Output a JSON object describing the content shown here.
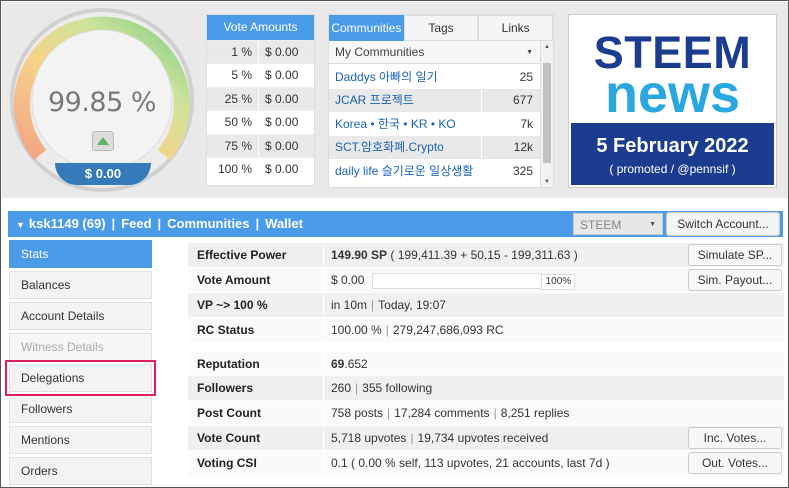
{
  "gauge": {
    "percent": "99.85 %",
    "usd": "$ 0.00",
    "value": 99.85
  },
  "vote_amounts": {
    "title": "Vote Amounts",
    "rows": [
      {
        "pct": "1 %",
        "usd": "$ 0.00"
      },
      {
        "pct": "5 %",
        "usd": "$ 0.00"
      },
      {
        "pct": "25 %",
        "usd": "$ 0.00"
      },
      {
        "pct": "50 %",
        "usd": "$ 0.00"
      },
      {
        "pct": "75 %",
        "usd": "$ 0.00"
      },
      {
        "pct": "100 %",
        "usd": "$ 0.00"
      }
    ]
  },
  "communities": {
    "tabs": [
      "Communities",
      "Tags",
      "Links"
    ],
    "selected": "My Communities",
    "rows": [
      {
        "name": "Daddys 아빠의 일기",
        "count": "25"
      },
      {
        "name": "JCAR 프로젝트",
        "count": "677"
      },
      {
        "name": "Korea • 한국 • KR • KO",
        "count": "7k"
      },
      {
        "name": "SCT.암호화폐.Crypto",
        "count": "12k"
      },
      {
        "name": "daily life 슬기로운 일상생활",
        "count": "325"
      }
    ]
  },
  "news": {
    "line1": "STEEM",
    "line2": "news",
    "date": "5 February 2022",
    "promo": "( promoted / @pennsif )"
  },
  "nav": {
    "account": "ksk1149 (69)",
    "links": [
      "Feed",
      "Communities",
      "Wallet"
    ],
    "chain": "STEEM",
    "switch": "Switch Account..."
  },
  "sidebar": {
    "items": [
      {
        "label": "Stats"
      },
      {
        "label": "Balances"
      },
      {
        "label": "Account Details"
      },
      {
        "label": "Witness Details"
      },
      {
        "label": "Delegations"
      },
      {
        "label": "Followers"
      },
      {
        "label": "Mentions"
      },
      {
        "label": "Orders"
      }
    ]
  },
  "stats": {
    "effective_power": {
      "label": "Effective Power",
      "value": "149.90 SP",
      "detail": "( 199,411.39 + 50.15 - 199,311.63 )",
      "button": "Simulate SP..."
    },
    "vote_amount": {
      "label": "Vote Amount",
      "value": "$ 0.00",
      "bar_pct": "100%",
      "button": "Sim. Payout..."
    },
    "vp": {
      "label": "VP ~> 100 %",
      "v1": "in 10m",
      "v2": "Today, 19:07"
    },
    "rc": {
      "label": "RC Status",
      "v1": "100.00 %",
      "v2": "279,247,686,093 RC"
    },
    "reputation": {
      "label": "Reputation",
      "value": "69",
      "decimal": ".652"
    },
    "followers": {
      "label": "Followers",
      "v1": "260",
      "v2": "355 following"
    },
    "post_count": {
      "label": "Post Count",
      "v1": "758 posts",
      "v2": "17,284 comments",
      "v3": "8,251 replies"
    },
    "vote_count": {
      "label": "Vote Count",
      "v1": "5,718 upvotes",
      "v2": "19,734 upvotes received",
      "button": "Inc. Votes..."
    },
    "voting_csi": {
      "label": "Voting CSI",
      "value": "0.1 ( 0.00 % self, 113 upvotes, 21 accounts, last 7d )",
      "button": "Out. Votes..."
    }
  }
}
